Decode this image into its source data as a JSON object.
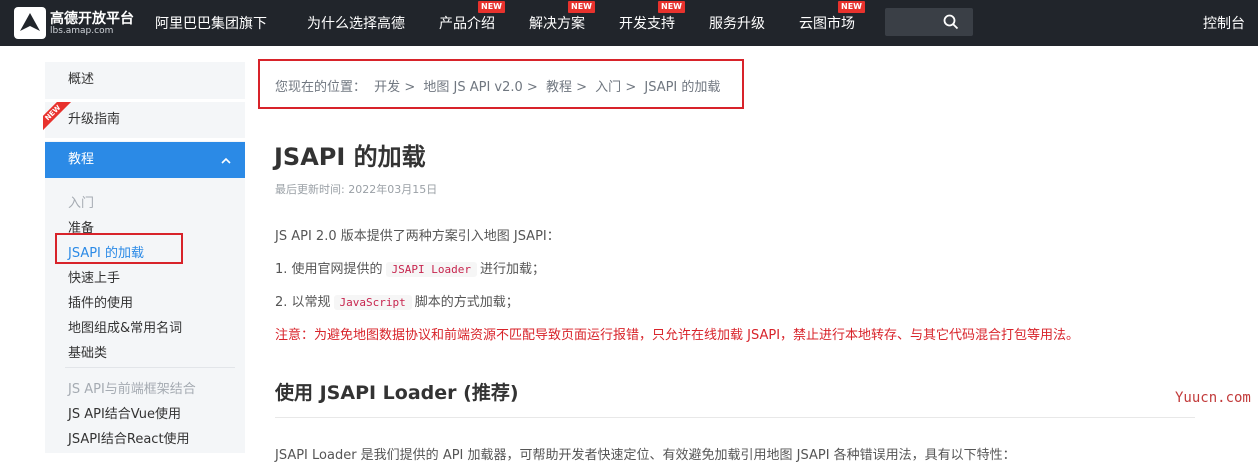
{
  "header": {
    "logo_text": "高德开放平台",
    "logo_sub": "lbs.amap.com",
    "org": "阿里巴巴集团旗下",
    "nav": [
      {
        "label": "为什么选择高德",
        "badge": ""
      },
      {
        "label": "产品介绍",
        "badge": "NEW"
      },
      {
        "label": "解决方案",
        "badge": "NEW"
      },
      {
        "label": "开发支持",
        "badge": "NEW"
      },
      {
        "label": "服务升级",
        "badge": ""
      },
      {
        "label": "云图市场",
        "badge": "NEW"
      }
    ],
    "search_placeholder": "",
    "console": "控制台"
  },
  "sidebar": {
    "items": [
      {
        "label": "概述"
      },
      {
        "label": "升级指南",
        "ribbon": "NEW"
      },
      {
        "label": "教程",
        "active": true
      }
    ],
    "sub_items": [
      {
        "label": "入门",
        "style": "muted"
      },
      {
        "label": "准备",
        "style": ""
      },
      {
        "label": "JSAPI 的加载",
        "style": "current"
      },
      {
        "label": "快速上手",
        "style": ""
      },
      {
        "label": "插件的使用",
        "style": ""
      },
      {
        "label": "地图组成&常用名词",
        "style": ""
      },
      {
        "label": "基础类",
        "style": ""
      },
      {
        "label": "JS API与前端框架结合",
        "style": "muted"
      },
      {
        "label": "JS API结合Vue使用",
        "style": ""
      },
      {
        "label": "JSAPI结合React使用",
        "style": ""
      }
    ]
  },
  "breadcrumb": {
    "prefix": "您现在的位置：",
    "path": [
      "开发",
      "地图 JS API v2.0",
      "教程",
      "入门",
      "JSAPI 的加载"
    ],
    "sep": ">"
  },
  "content": {
    "title": "JSAPI 的加载",
    "updated": "最后更新时间: 2022年03月15日",
    "intro": "JS API 2.0 版本提供了两种方案引入地图 JSAPI：",
    "item1_pre": "1. 使用官网提供的",
    "item1_code": "JSAPI Loader",
    "item1_post": "进行加载；",
    "item2_pre": "2. 以常规",
    "item2_code": "JavaScript",
    "item2_post": "脚本的方式加载；",
    "warning": "注意：为避免地图数据协议和前端资源不匹配导致页面运行报错，只允许在线加载 JSAPI，禁止进行本地转存、与其它代码混合打包等用法。",
    "h2": "使用 JSAPI Loader (推荐)",
    "truncated": "JSAPI Loader 是我们提供的 API 加载器，可帮助开发者快速定位、有效避免加载引用地图 JSAPI 各种错误用法，具有以下特性："
  },
  "watermark": "Yuucn.com",
  "colors": {
    "nav_bg": "#21252b",
    "accent": "#2b8ae6",
    "badge": "#e8322d",
    "highlight_box": "#d8232a"
  }
}
